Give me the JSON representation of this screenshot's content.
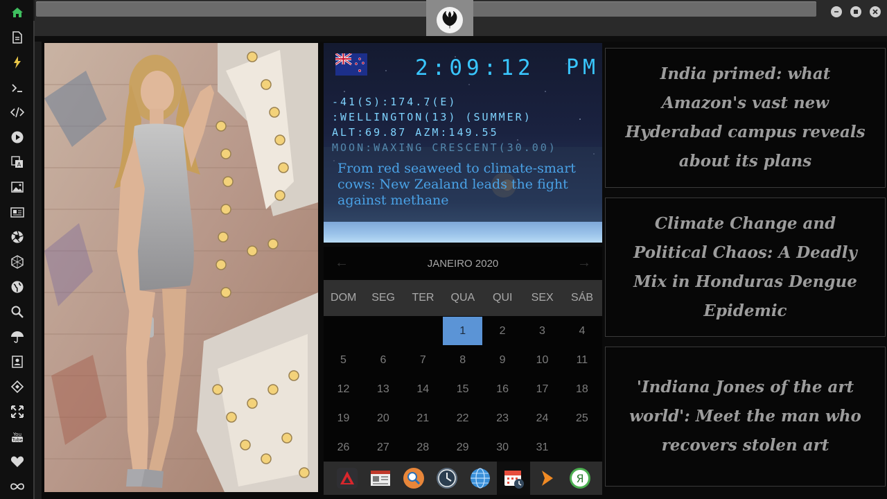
{
  "sidebar": {
    "icons": [
      "home-icon",
      "document-icon",
      "flash-icon",
      "terminal-icon",
      "code-icon",
      "play-icon",
      "translate-icon",
      "image-icon",
      "news-icon",
      "aperture-icon",
      "hexagon-icon",
      "globe-icon",
      "search-icon",
      "umbrella-icon",
      "contact-icon",
      "tag-icon",
      "expand-icon",
      "youtube-icon",
      "heart-icon",
      "infinity-icon"
    ],
    "active_color": "#3fbf5f",
    "youtube_label": "You Tube"
  },
  "clock": {
    "time": "2:09:12",
    "ampm": "PM",
    "coords": "-41(S):174.7(E)",
    "location": ":WELLINGTON(13) (SUMMER)",
    "alt_azm": "ALT:69.87 AZM:149.55",
    "moon": "MOON:WAXING CRESCENT(30.00)",
    "headline": "From red seaweed to climate-smart cows: New Zealand leads the fight against methane",
    "lcd_color": "#39c6ff"
  },
  "calendar": {
    "month": "JANEIRO 2020",
    "days_of_week": [
      "DOM",
      "SEG",
      "TER",
      "QUA",
      "QUI",
      "SEX",
      "SÁB"
    ],
    "first_weekday": 3,
    "num_days": 31,
    "selected_day": 1,
    "accent_color": "#5b94d6"
  },
  "dock": {
    "items": [
      "app-launcher-icon",
      "news-reader-icon",
      "search-app-icon",
      "clock-app-icon",
      "browser-icon",
      "calendar-app-icon",
      "play-arrow-icon",
      "yandex-icon"
    ],
    "active_index": 5
  },
  "news": [
    {
      "title": "India primed: what Amazon's vast new Hyderabad campus reveals about its plans"
    },
    {
      "title": "Climate Change and Political Chaos: A Deadly Mix in Honduras Dengue Epidemic"
    },
    {
      "title": "'Indiana Jones of the art world': Meet the man who recovers stolen art"
    }
  ]
}
